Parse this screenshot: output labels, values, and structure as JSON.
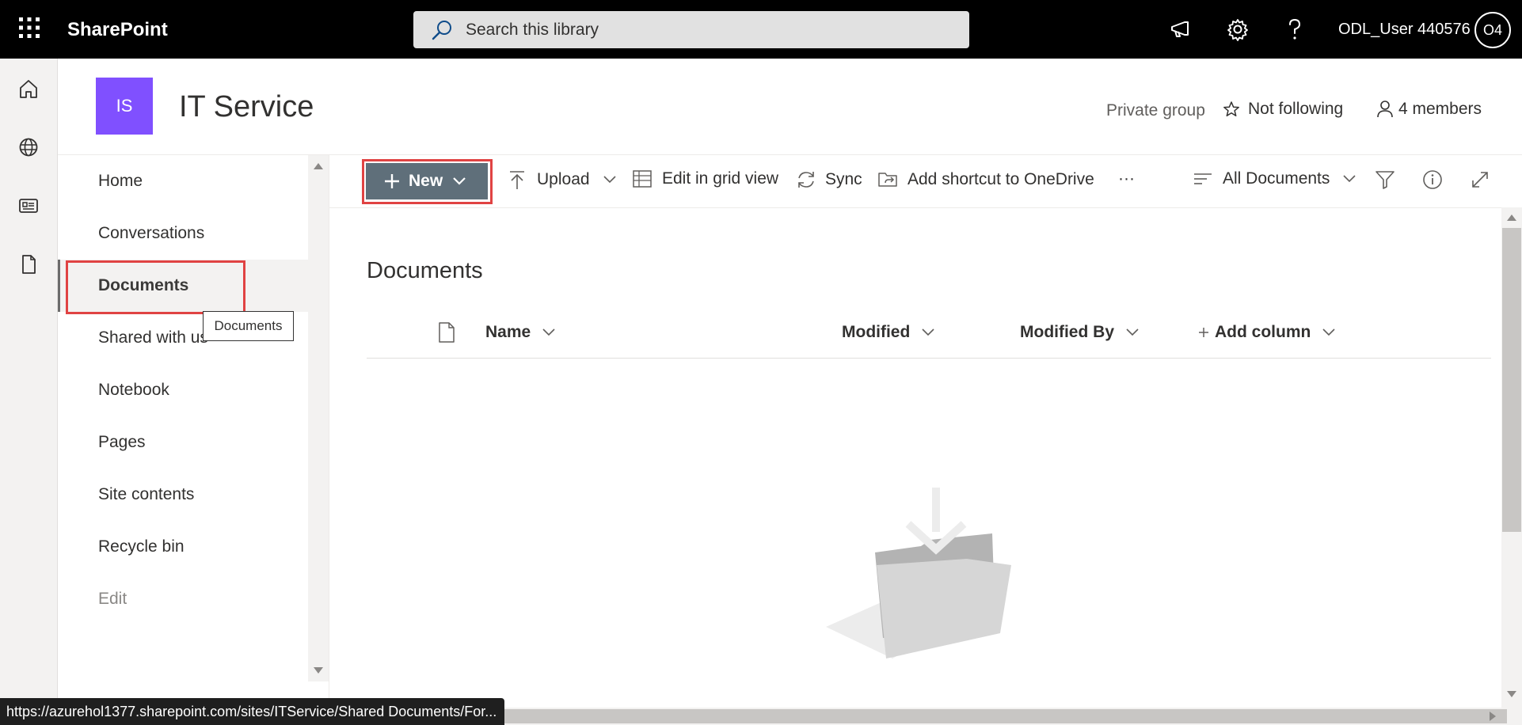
{
  "suite": {
    "app_name": "SharePoint",
    "search_placeholder": "Search this library",
    "user_name": "ODL_User 440576",
    "avatar_initials": "O4"
  },
  "site": {
    "logo_initials": "IS",
    "logo_color": "#8050ff",
    "title": "IT Service",
    "privacy": "Private group",
    "follow_label": "Not following",
    "members_label": "4 members"
  },
  "nav": {
    "items": [
      {
        "label": "Home"
      },
      {
        "label": "Conversations"
      },
      {
        "label": "Documents"
      },
      {
        "label": "Shared with us"
      },
      {
        "label": "Notebook"
      },
      {
        "label": "Pages"
      },
      {
        "label": "Site contents"
      },
      {
        "label": "Recycle bin"
      },
      {
        "label": "Edit"
      }
    ],
    "selected": "Documents",
    "tooltip": "Documents"
  },
  "commandbar": {
    "new_label": "New",
    "upload_label": "Upload",
    "grid_label": "Edit in grid view",
    "sync_label": "Sync",
    "shortcut_label": "Add shortcut to OneDrive",
    "more_label": "···",
    "view_label": "All Documents"
  },
  "library": {
    "title": "Documents",
    "columns": {
      "name": "Name",
      "modified": "Modified",
      "modified_by": "Modified By",
      "add_column": "Add column"
    }
  },
  "statusbar": {
    "url": "https://azurehol1377.sharepoint.com/sites/ITService/Shared Documents/For..."
  },
  "colors": {
    "suitebar": "#000000",
    "new_button": "#5f6f7a",
    "highlight": "#e04343"
  }
}
